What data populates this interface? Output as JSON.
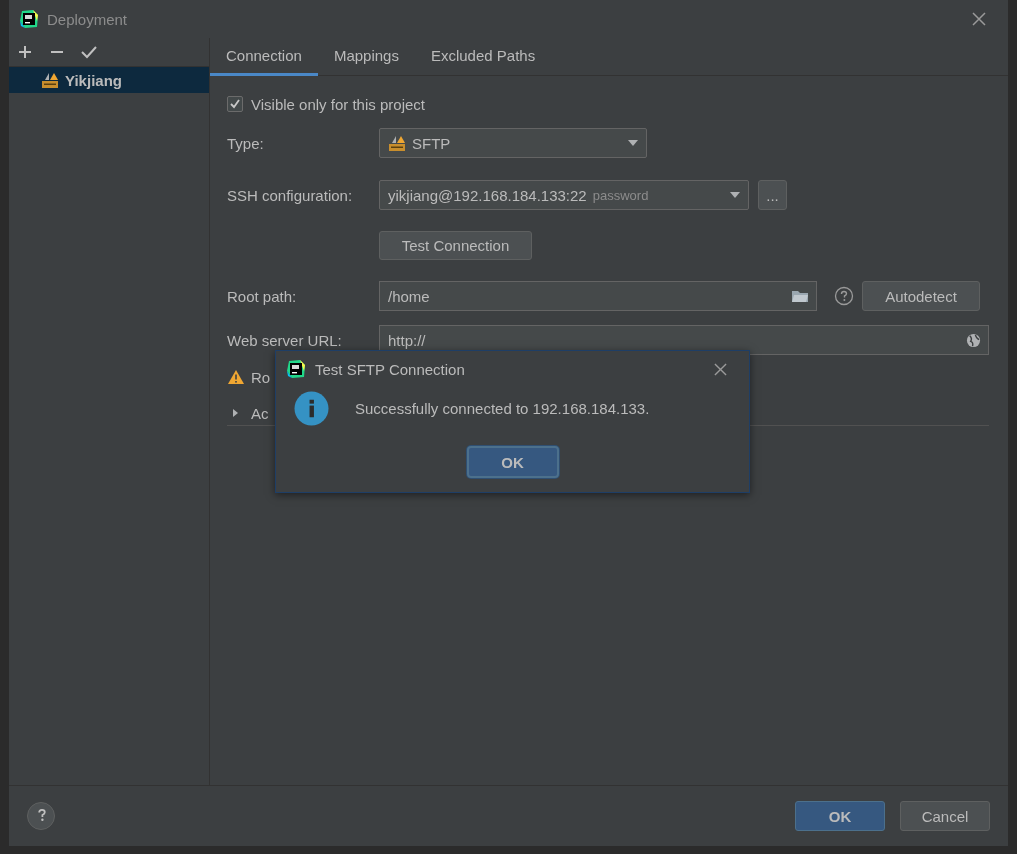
{
  "window": {
    "title": "Deployment"
  },
  "servers": [
    {
      "name": "Yikjiang",
      "selected": true
    }
  ],
  "tabs": [
    {
      "label": "Connection",
      "selected": true
    },
    {
      "label": "Mappings",
      "selected": false
    },
    {
      "label": "Excluded Paths",
      "selected": false
    }
  ],
  "visible_only": {
    "label": "Visible only for this project",
    "checked": true
  },
  "type": {
    "label": "Type:",
    "value": "SFTP"
  },
  "ssh": {
    "label": "SSH configuration:",
    "value": "yikjiang@192.168.184.133:22",
    "hint": "password",
    "more": "..."
  },
  "test_button": "Test Connection",
  "root_path": {
    "label": "Root path:",
    "value": "/home",
    "autodetect": "Autodetect"
  },
  "web_url": {
    "label": "Web server URL:",
    "value": "http://"
  },
  "warning": {
    "text": "Ro"
  },
  "advanced": {
    "text": "Ac",
    "expanded": false
  },
  "message_dialog": {
    "title": "Test SFTP Connection",
    "message": "Successfully connected to 192.168.184.133.",
    "button": "OK"
  },
  "footer": {
    "buttons": [
      {
        "label": "OK",
        "kind": "primary"
      },
      {
        "label": "Cancel",
        "kind": "secondary"
      }
    ]
  }
}
